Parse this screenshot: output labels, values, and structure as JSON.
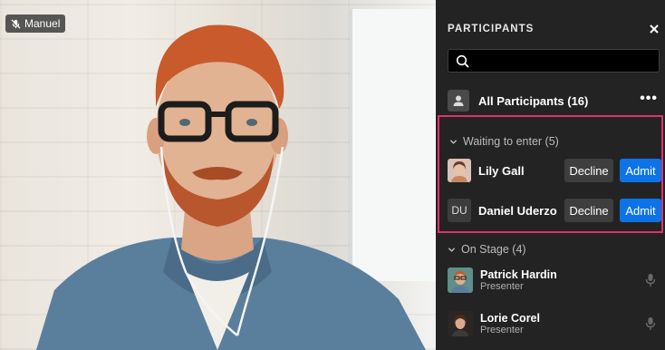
{
  "video": {
    "speaker_name": "Manuel",
    "muted_icon": "mic-off-icon"
  },
  "panel": {
    "title": "PARTICIPANTS",
    "close_icon": "close-icon",
    "search": {
      "icon": "search-icon",
      "value": "",
      "placeholder": ""
    },
    "all_participants": {
      "label": "All Participants (16)",
      "more_label": "•••"
    },
    "waiting": {
      "label": "Waiting to enter (5)",
      "highlight_color": "#e0306a",
      "people": [
        {
          "name": "Lily Gall",
          "decline_label": "Decline",
          "admit_label": "Admit"
        },
        {
          "name": "Daniel Uderzo",
          "initials": "DU",
          "decline_label": "Decline",
          "admit_label": "Admit"
        }
      ]
    },
    "on_stage": {
      "label": "On Stage (4)",
      "people": [
        {
          "name": "Patrick Hardin",
          "role": "Presenter"
        },
        {
          "name": "Lorie Corel",
          "role": "Presenter"
        }
      ]
    }
  },
  "colors": {
    "panel_bg": "#232323",
    "admit_blue": "#0d73e8",
    "decline_gray": "#3e3e3e"
  }
}
